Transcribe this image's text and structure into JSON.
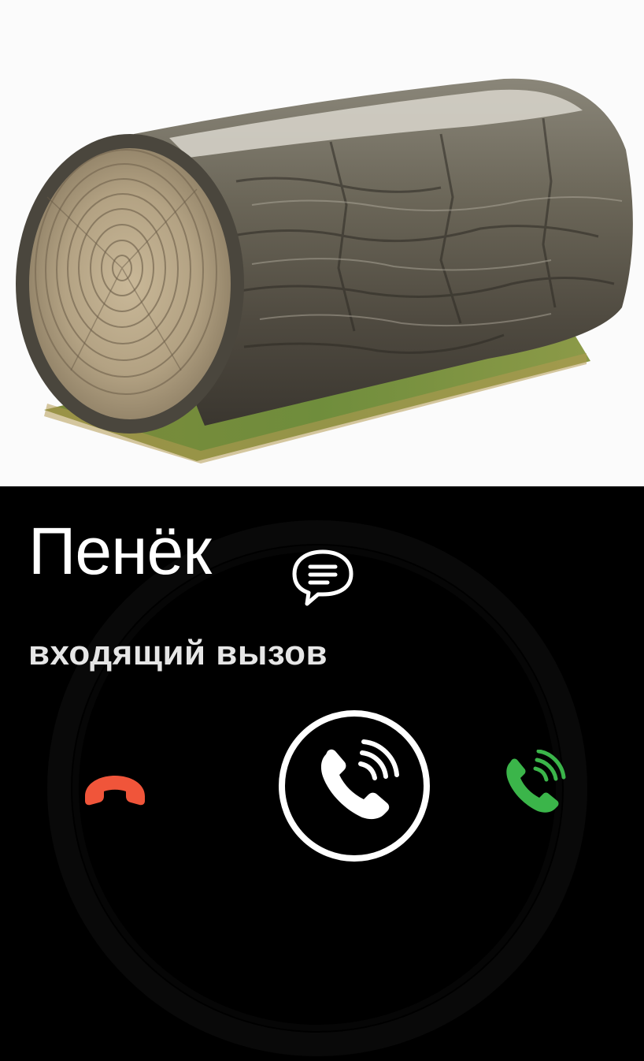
{
  "photo": {
    "subject": "log-planter-photo"
  },
  "call": {
    "caller_name": "Пенёк",
    "status": "входящий вызов"
  },
  "controls": {
    "message_icon": "message-bubble-icon",
    "decline_icon": "phone-hangup-icon",
    "answer_icon": "phone-ringing-icon",
    "accept_icon": "phone-ringing-icon"
  },
  "colors": {
    "background": "#000000",
    "text": "#ffffff",
    "decline": "#f0553a",
    "accept": "#3bb54a",
    "photo_background": "#fbfbfb"
  }
}
